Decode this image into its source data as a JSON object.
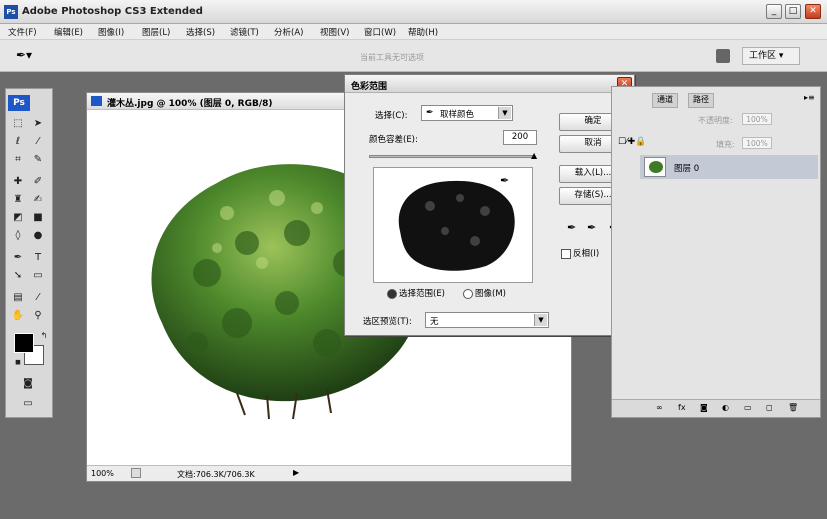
{
  "window": {
    "title": "Adobe Photoshop CS3 Extended"
  },
  "menu": [
    "文件(F)",
    "编辑(E)",
    "图像(I)",
    "图层(L)",
    "选择(S)",
    "滤镜(T)",
    "分析(A)",
    "视图(V)",
    "窗口(W)",
    "帮助(H)"
  ],
  "options_bar": {
    "hint": "当前工具无可选项",
    "workspace_label": "工作区 ▾"
  },
  "document": {
    "title": "灌木丛.jpg @ 100% (图层 0, RGB/8)",
    "zoom": "100%",
    "doc_info": "文档:706.3K/706.3K"
  },
  "dialog": {
    "title": "色彩范围",
    "select_label": "选择(C):",
    "select_value": "取样颜色",
    "fuzziness_label": "颜色容差(E):",
    "fuzziness_value": "200",
    "radio_selection": "选择范围(E)",
    "radio_image": "图像(M)",
    "selection_preview_label": "选区预览(T):",
    "selection_preview_value": "无",
    "ok": "确定",
    "cancel": "取消",
    "load": "载入(L)...",
    "save": "存储(S)...",
    "invert": "反相(I)"
  },
  "layers_panel": {
    "tabs": [
      "通道",
      "路径"
    ],
    "opacity_label": "不透明度:",
    "opacity_value": "100%",
    "fill_label": "填充:",
    "fill_value": "100%",
    "layer_name": "图层 0"
  },
  "colors": {
    "foreground": "#000000",
    "background": "#ffffff",
    "accent": "#1e57c8"
  }
}
